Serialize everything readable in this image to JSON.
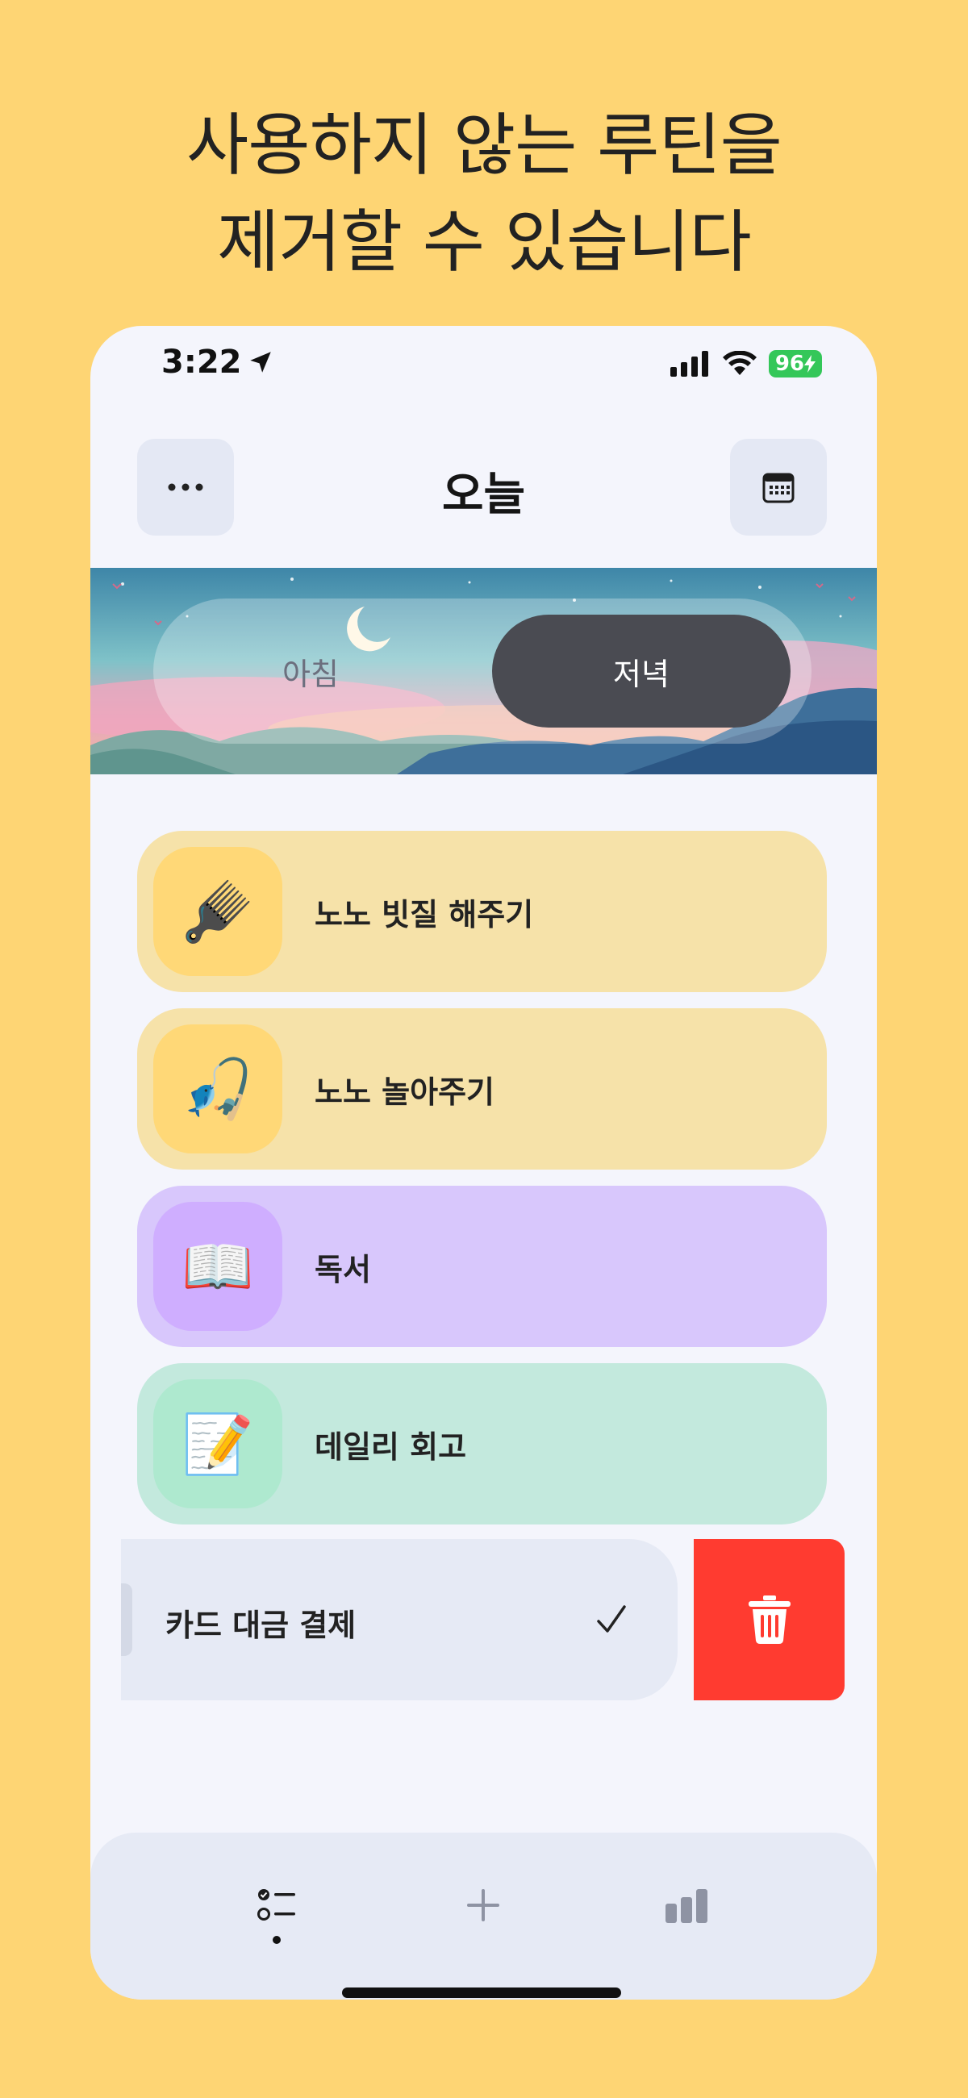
{
  "headline": {
    "line1": "사용하지 않는 루틴을",
    "line2": "제거할 수 있습니다"
  },
  "status_bar": {
    "time": "3:22",
    "battery": "96"
  },
  "header": {
    "title": "오늘"
  },
  "segment": {
    "morning": "아침",
    "evening": "저녁",
    "selected": "저녁"
  },
  "routines": [
    {
      "label": "노노 빗질 해주기",
      "icon": "🪮",
      "icon_name": "hair-pick-icon",
      "bg": "#F6E2A9",
      "icon_bg": "#FFD877"
    },
    {
      "label": "노노 놀아주기",
      "icon": "🎣",
      "icon_name": "fishing-pole-icon",
      "bg": "#F6E2A9",
      "icon_bg": "#FFD877"
    },
    {
      "label": "독서",
      "icon": "📖",
      "icon_name": "open-book-icon",
      "bg": "#D8C7FC",
      "icon_bg": "#CFAEFF"
    },
    {
      "label": "데일리 회고",
      "icon": "📝",
      "icon_name": "memo-icon",
      "bg": "#C3E9DD",
      "icon_bg": "#AEE9CF"
    }
  ],
  "swiped_routine": {
    "label": "카드 대금 결제",
    "check": "✓",
    "delete_color": "#FF3B30"
  },
  "colors": {
    "background": "#FED574",
    "phone": "#F4F5FC",
    "accent_dark": "#4A4B52"
  }
}
